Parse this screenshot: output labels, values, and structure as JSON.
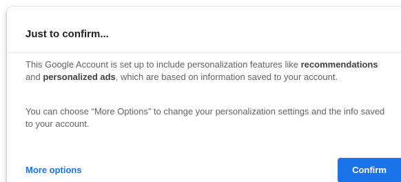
{
  "dialog": {
    "title": "Just to confirm...",
    "paragraph1": {
      "text_before": "This Google Account is set up to include personalization features like ",
      "bold1": "recommendations",
      "text_middle": " and ",
      "bold2": "personalized ads",
      "text_after": ", which are based on information saved to your account."
    },
    "paragraph2": "You can choose “More Options” to change your personalization settings and the info saved to your account.",
    "more_options_label": "More options",
    "confirm_label": "Confirm"
  },
  "colors": {
    "accent": "#1a73e8",
    "title_text": "#202124",
    "body_text": "#5f6368",
    "divider": "#e8eaed"
  }
}
